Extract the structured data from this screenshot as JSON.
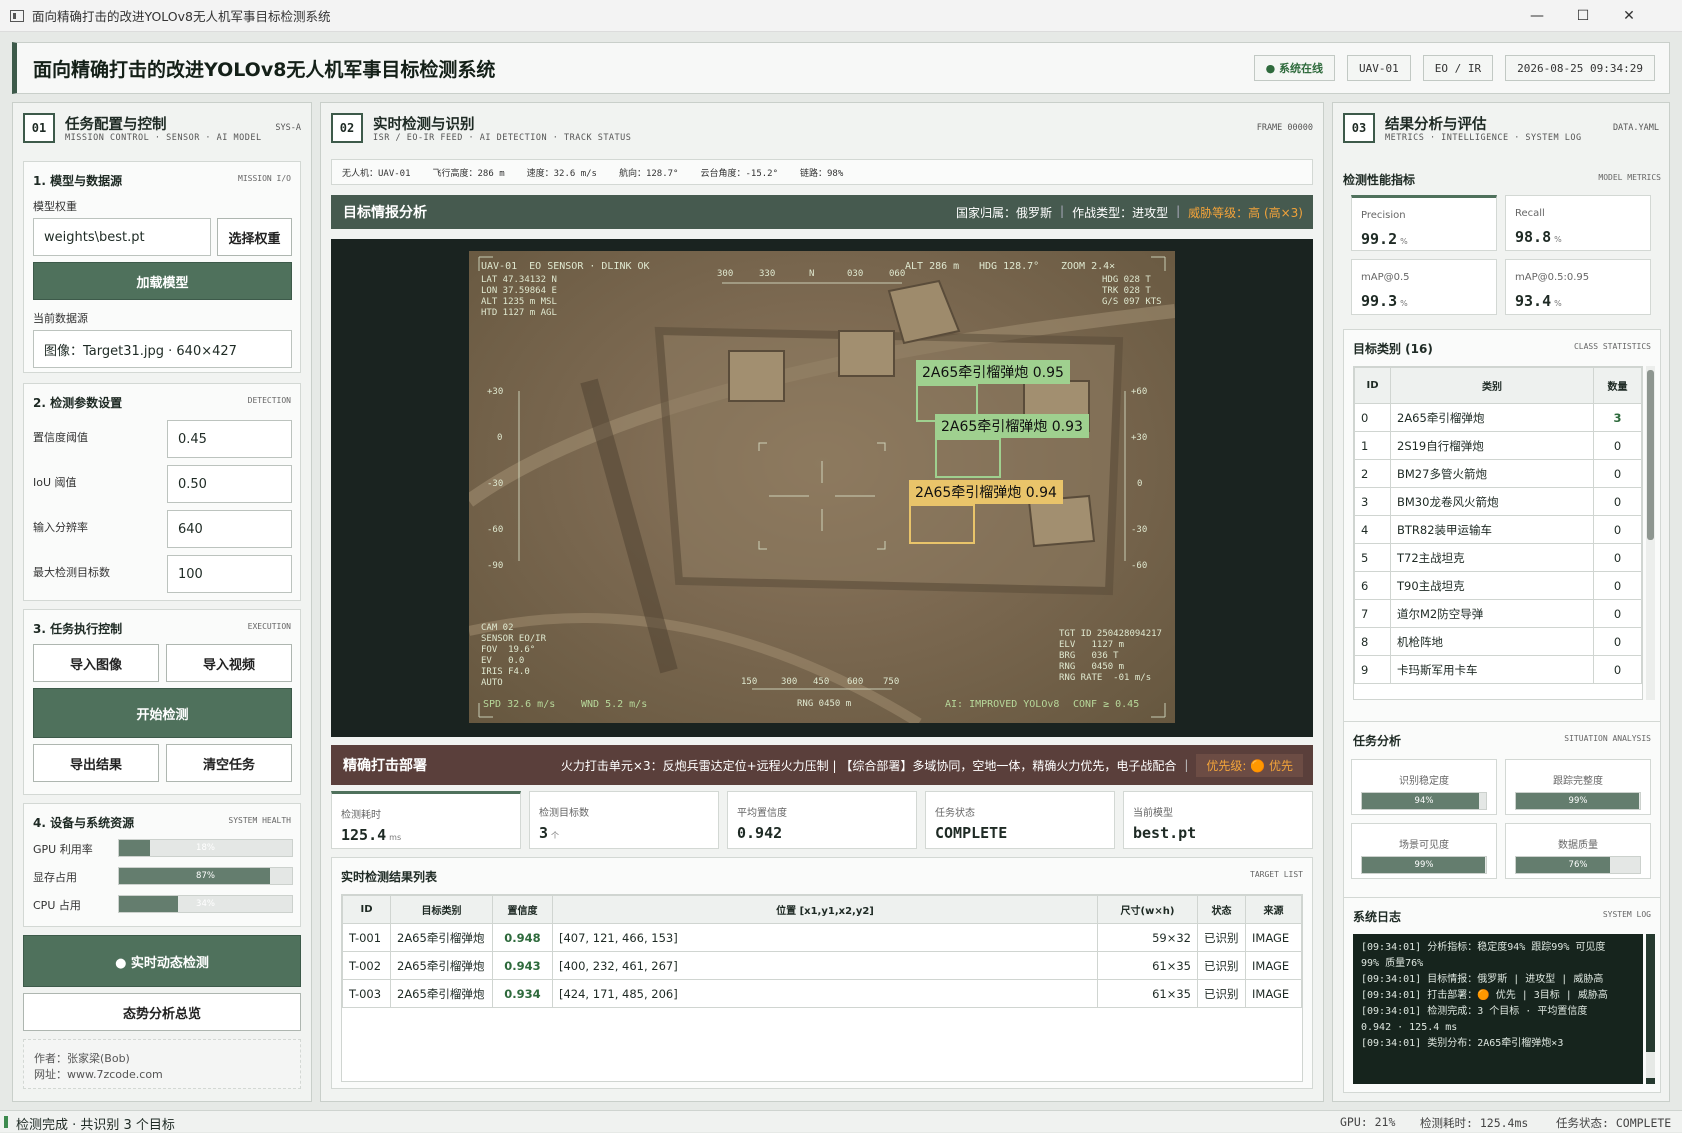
{
  "window": {
    "title": "面向精确打击的改进YOLOv8无人机军事目标检测系统",
    "min": "—",
    "max": "☐",
    "close": "✕"
  },
  "header": {
    "title": "面向精确打击的改进YOLOv8无人机军事目标检测系统",
    "status": "● 系统在线",
    "uav": "UAV-01",
    "mode": "EO / IR",
    "datetime": "2026-08-25 09:34:29"
  },
  "left": {
    "num": "01",
    "title": "任务配置与控制",
    "sub": "MISSION CONTROL · SENSOR · AI MODEL",
    "tag": "SYS-A",
    "model": {
      "head": "1. 模型与数据源",
      "tag": "MISSION I/O",
      "weights_label": "模型权重",
      "weights_value": "weights\\best.pt",
      "choose_btn": "选择权重",
      "load_btn": "加载模型",
      "source_label": "当前数据源",
      "source_value": "图像：Target31.jpg · 640×427"
    },
    "params": {
      "head": "2. 检测参数设置",
      "tag": "DETECTION",
      "rows": [
        {
          "label": "置信度阈值",
          "value": "0.45"
        },
        {
          "label": "IoU 阈值",
          "value": "0.50"
        },
        {
          "label": "输入分辨率",
          "value": "640"
        },
        {
          "label": "最大检测目标数",
          "value": "100"
        }
      ]
    },
    "exec": {
      "head": "3. 任务执行控制",
      "tag": "EXECUTION",
      "import_img": "导入图像",
      "import_video": "导入视频",
      "start": "开始检测",
      "export": "导出结果",
      "clear": "清空任务"
    },
    "health": {
      "head": "4. 设备与系统资源",
      "tag": "SYSTEM HEALTH",
      "rows": [
        {
          "label": "GPU 利用率",
          "value": "18%",
          "pct": 0.18
        },
        {
          "label": "显存占用",
          "value": "87%",
          "pct": 0.87
        },
        {
          "label": "CPU 占用",
          "value": "34%",
          "pct": 0.34
        }
      ]
    },
    "realtime_btn": "● 实时动态检测",
    "situation_btn": "态势分析总览",
    "author": "作者：张家梁(Bob)",
    "site": "网址：www.7zcode.com"
  },
  "center": {
    "num": "02",
    "title": "实时检测与识别",
    "sub": "ISR / EO-IR FEED · AI DETECTION · TRACK STATUS",
    "tag": "FRAME 00000",
    "telemetry": [
      "无人机：UAV-01",
      "飞行高度：286 m",
      "速度：32.6 m/s",
      "航向：128.7°",
      "云台角度：-15.2°",
      "链路：98%"
    ],
    "intel": {
      "title": "目标情报分析",
      "country": "国家归属：俄罗斯",
      "combat": "作战类型：进攻型",
      "threat": "威胁等级：高 (高×3)",
      "sep": "|"
    },
    "hud": {
      "top_left": "UAV-01  EO SENSOR · DLINK OK",
      "top_alt": "ALT 286 m",
      "top_hdg": "HDG 128.7°",
      "top_zoom": "ZOOM 2.4×",
      "left_block": "LAT 47.34132 N\nLON 37.59864 E\nALT 1235 m MSL\nHTD 1127 m AGL",
      "right_block": "HDG 028 T\nTRK 028 T\nG/S 097 KTS",
      "compass": [
        "300",
        "330",
        "N",
        "030",
        "060"
      ],
      "pitch_left": [
        "+30",
        "0",
        "-30",
        "-60",
        "-90"
      ],
      "pitch_right": [
        "+60",
        "+30",
        "0",
        "-30",
        "-60"
      ],
      "bottom_left_block": "CAM 02\nSENSOR EO/IR\nFOV  19.6°\nEV   0.0\nIRIS F4.0\nAUTO",
      "bottom_right_block": "TGT ID 250428094217\nELV   1127 m\nBRG   036 T\nRNG   0450 m\nRNG RATE  -01 m/s",
      "range_ticks": [
        "150",
        "300",
        "450",
        "600",
        "750"
      ],
      "rng": "RNG 0450 m",
      "spd": "SPD 32.6 m/s",
      "wnd": "WND 5.2 m/s",
      "ai": "AI: IMPROVED YOLOv8",
      "conf": "CONF ≥ 0.45"
    },
    "detections": [
      {
        "label": "2A65牵引榴弹炮  0.95",
        "color": "#9fd08f"
      },
      {
        "label": "2A65牵引榴弹炮  0.93",
        "color": "#9fd08f"
      },
      {
        "label": "2A65牵引榴弹炮  0.94",
        "color": "#e9c46a"
      }
    ],
    "strike": {
      "title": "精确打击部署",
      "text": "火力打击单元×3：反炮兵雷达定位+远程火力压制 | 【综合部署】多域协同，空地一体，精确火力优先，电子战配合",
      "priority": "优先级: 🟠 优先",
      "sep": "|"
    },
    "stats": [
      {
        "label": "检测耗时",
        "value": "125.4",
        "unit": "ms"
      },
      {
        "label": "检测目标数",
        "value": "3",
        "unit": "个"
      },
      {
        "label": "平均置信度",
        "value": "0.942",
        "unit": ""
      },
      {
        "label": "任务状态",
        "value": "COMPLETE",
        "unit": ""
      },
      {
        "label": "当前模型",
        "value": "best.pt",
        "unit": ""
      }
    ],
    "results": {
      "head": "实时检测结果列表",
      "tag": "TARGET LIST",
      "columns": [
        "ID",
        "目标类别",
        "置信度",
        "位置 [x1,y1,x2,y2]",
        "尺寸(w×h)",
        "状态",
        "来源"
      ],
      "rows": [
        [
          "T-001",
          "2A65牵引榴弹炮",
          "0.948",
          "[407, 121, 466, 153]",
          "59×32",
          "已识别",
          "IMAGE"
        ],
        [
          "T-002",
          "2A65牵引榴弹炮",
          "0.943",
          "[400, 232, 461, 267]",
          "61×35",
          "已识别",
          "IMAGE"
        ],
        [
          "T-003",
          "2A65牵引榴弹炮",
          "0.934",
          "[424, 171, 485, 206]",
          "61×35",
          "已识别",
          "IMAGE"
        ]
      ]
    }
  },
  "right": {
    "num": "03",
    "title": "结果分析与评估",
    "sub": "METRICS · INTELLIGENCE · SYSTEM LOG",
    "tag": "DATA.YAML",
    "metrics": {
      "head": "检测性能指标",
      "tag": "MODEL METRICS",
      "items": [
        {
          "label": "Precision",
          "value": "99.2",
          "unit": "%"
        },
        {
          "label": "Recall",
          "value": "98.8",
          "unit": "%"
        },
        {
          "label": "mAP@0.5",
          "value": "99.3",
          "unit": "%"
        },
        {
          "label": "mAP@0.5:0.95",
          "value": "93.4",
          "unit": "%"
        }
      ]
    },
    "classes": {
      "head": "目标类别 (16)",
      "tag": "CLASS STATISTICS",
      "columns": [
        "ID",
        "类别",
        "数量"
      ],
      "rows": [
        [
          "0",
          "2A65牵引榴弹炮",
          "3"
        ],
        [
          "1",
          "2S19自行榴弹炮",
          "0"
        ],
        [
          "2",
          "BM27多管火箭炮",
          "0"
        ],
        [
          "3",
          "BM30龙卷风火箭炮",
          "0"
        ],
        [
          "4",
          "BTR82装甲运输车",
          "0"
        ],
        [
          "5",
          "T72主战坦克",
          "0"
        ],
        [
          "6",
          "T90主战坦克",
          "0"
        ],
        [
          "7",
          "道尔M2防空导弹",
          "0"
        ],
        [
          "8",
          "机枪阵地",
          "0"
        ],
        [
          "9",
          "卡玛斯军用卡车",
          "0"
        ]
      ]
    },
    "situation": {
      "head": "任务分析",
      "tag": "SITUATION ANALYSIS",
      "items": [
        {
          "label": "识别稳定度",
          "value": "94%",
          "pct": 0.94
        },
        {
          "label": "跟踪完整度",
          "value": "99%",
          "pct": 0.99
        },
        {
          "label": "场景可见度",
          "value": "99%",
          "pct": 0.99
        },
        {
          "label": "数据质量",
          "value": "76%",
          "pct": 0.76
        }
      ]
    },
    "log": {
      "head": "系统日志",
      "tag": "SYSTEM LOG",
      "lines": [
        "[09:34:01]  分析指标：稳定度94% 跟踪99% 可见度",
        "99% 质量76%",
        "[09:34:01]  目标情报：俄罗斯 | 进攻型 | 威胁高",
        "[09:34:01]  打击部署：🟠 优先 | 3目标 | 威胁高",
        "[09:34:01]  检测完成：3 个目标 · 平均置信度",
        "0.942 · 125.4 ms",
        "[09:34:01]  类别分布：2A65牵引榴弹炮×3"
      ]
    }
  },
  "statusbar": {
    "left": "检测完成 · 共识别 3 个目标",
    "gpu": "GPU: 21%",
    "time": "检测耗时: 125.4ms",
    "task": "任务状态: COMPLETE"
  }
}
